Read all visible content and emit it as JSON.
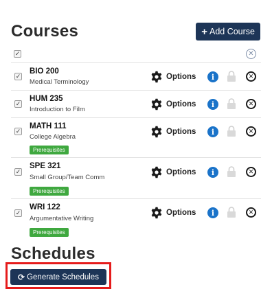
{
  "courses_section": {
    "title": "Courses",
    "add_course_label": "Add Course"
  },
  "courses": [
    {
      "code": "BIO 200",
      "name": "Medical Terminology",
      "options_label": "Options",
      "prerequisites": ""
    },
    {
      "code": "HUM 235",
      "name": "Introduction to Film",
      "options_label": "Options",
      "prerequisites": ""
    },
    {
      "code": "MATH 111",
      "name": "College Algebra",
      "options_label": "Options",
      "prerequisites": "Prerequisites"
    },
    {
      "code": "SPE 321",
      "name": "Small Group/Team Comm",
      "options_label": "Options",
      "prerequisites": "Prerequisites"
    },
    {
      "code": "WRI 122",
      "name": "Argumentative Writing",
      "options_label": "Options",
      "prerequisites": "Prerequisites"
    }
  ],
  "schedules_section": {
    "title": "Schedules",
    "generate_label": "Generate Schedules"
  },
  "icons": {
    "add": "plus-icon",
    "options": "gear-icon",
    "info": "info-icon",
    "lock": "lock-icon",
    "remove": "remove-icon",
    "generate": "refresh-icon"
  },
  "colors": {
    "primary_button": "#1d3557",
    "prerequisite_badge": "#3fa83f",
    "info": "#1a73c9",
    "highlight": "#e51b1b"
  }
}
